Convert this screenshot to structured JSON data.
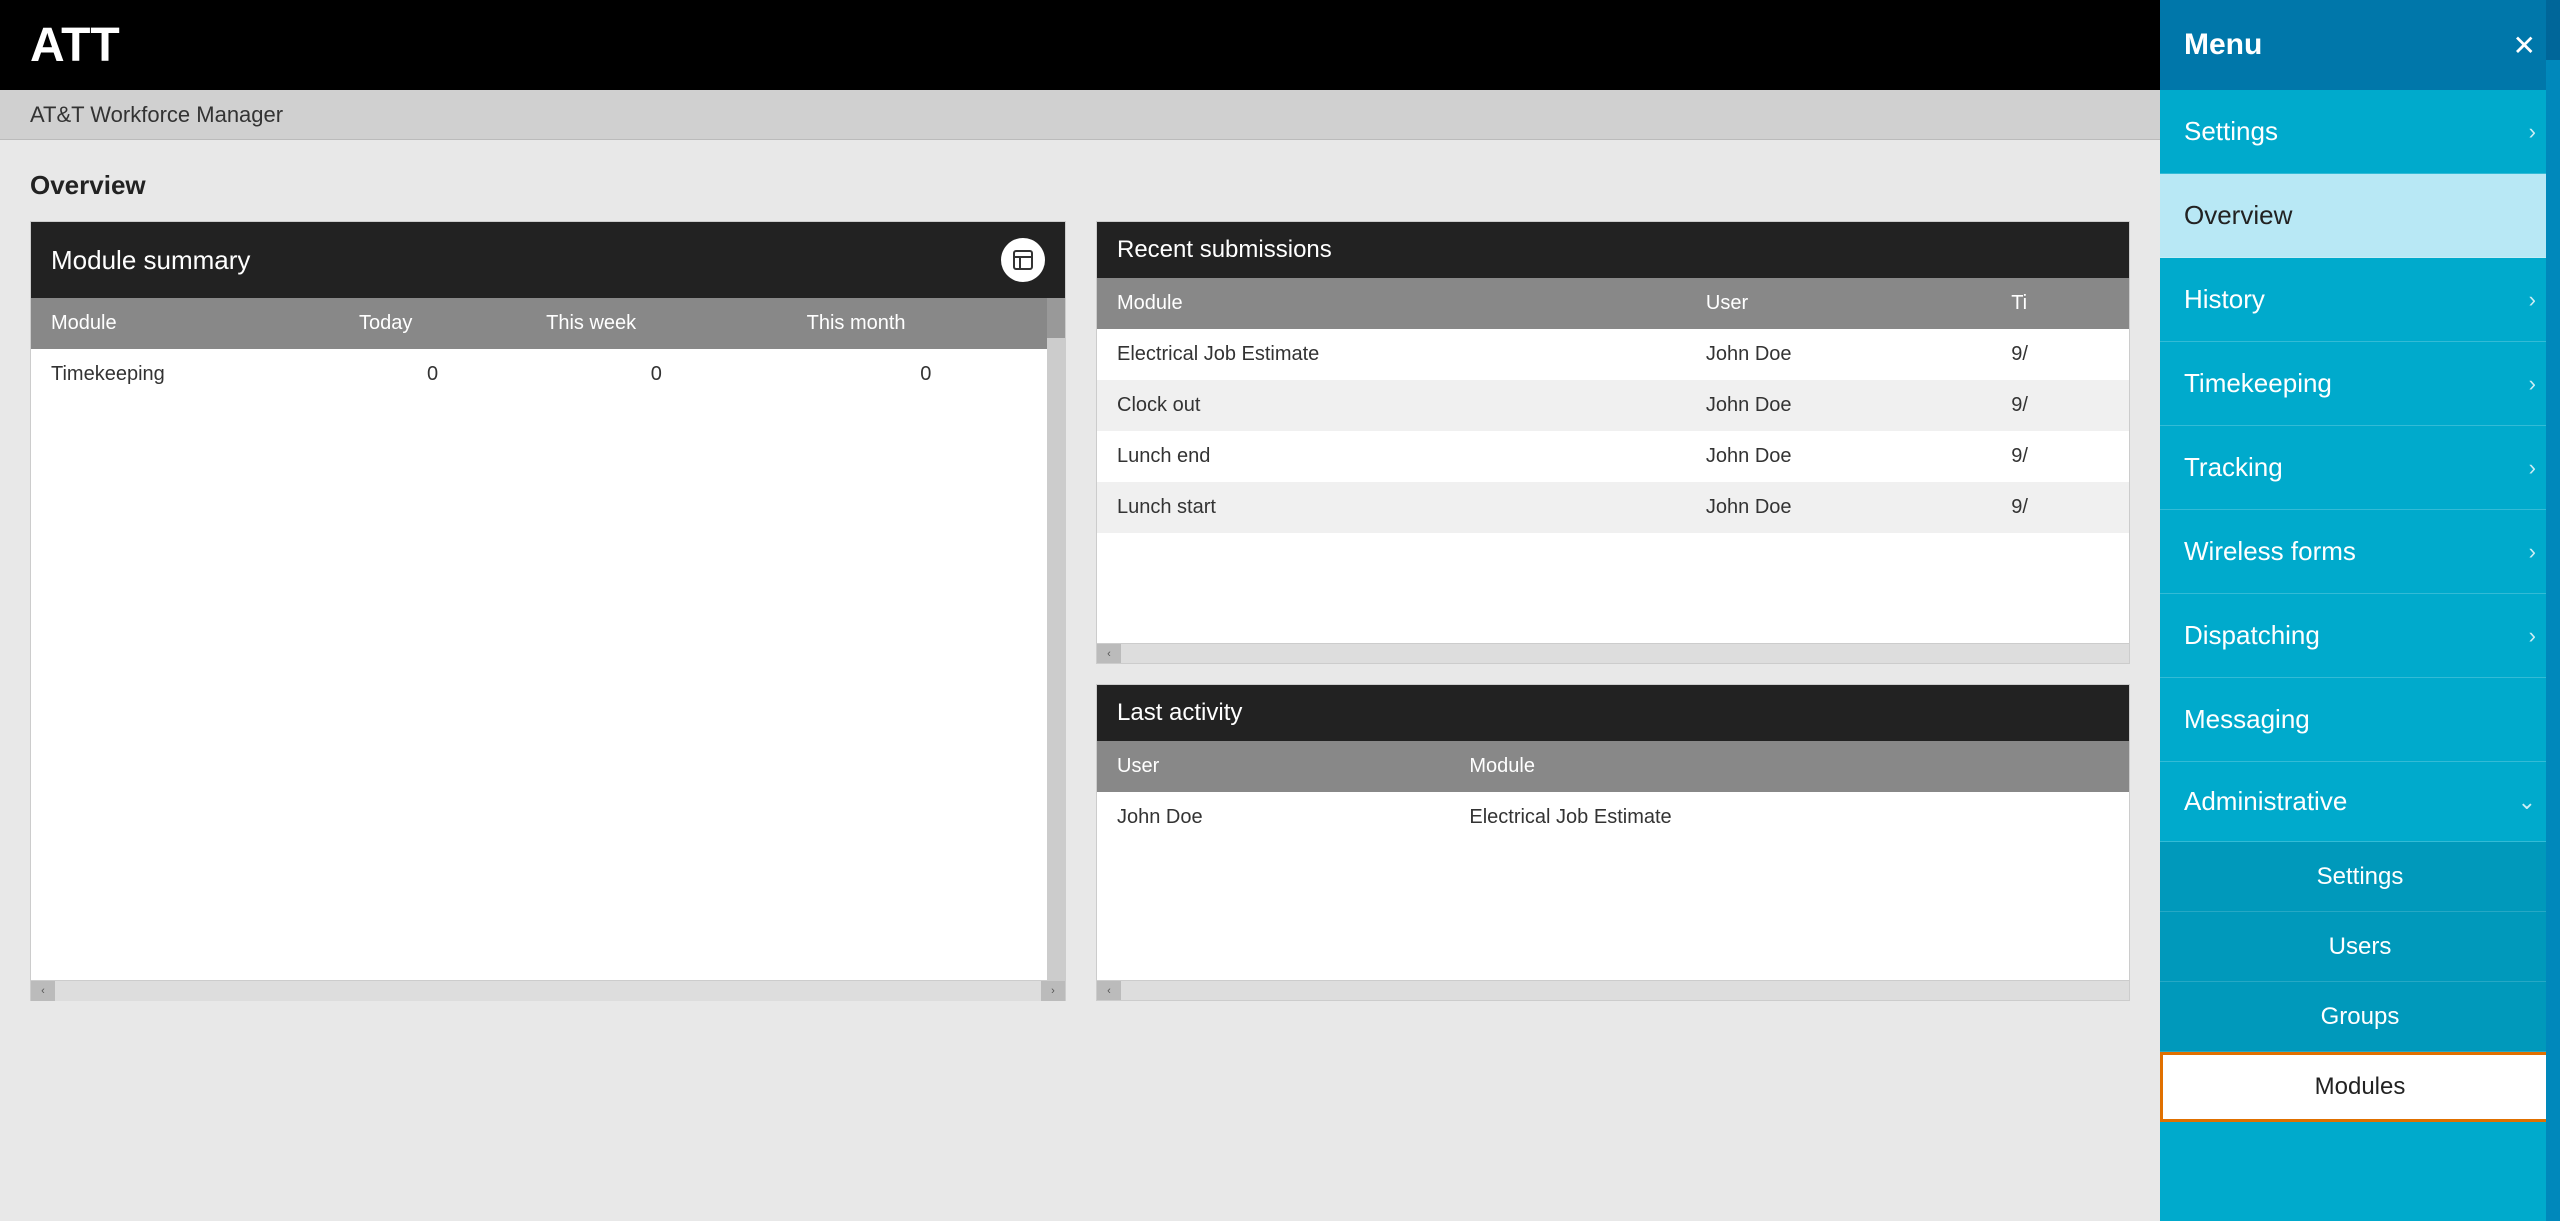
{
  "app": {
    "title": "ATT",
    "subtitle": "AT&T Workforce Manager"
  },
  "overview": {
    "title": "Overview"
  },
  "module_summary": {
    "panel_title": "Module summary",
    "columns": [
      "Module",
      "Today",
      "This week",
      "This month"
    ],
    "rows": [
      {
        "module": "Timekeeping",
        "today": "0",
        "this_week": "0",
        "this_month": "0"
      }
    ]
  },
  "recent_submissions": {
    "panel_title": "Recent submissions",
    "columns": [
      "Module",
      "User",
      "Ti"
    ],
    "rows": [
      {
        "module": "Electrical Job Estimate",
        "user": "John Doe",
        "time": "9/"
      },
      {
        "module": "Clock out",
        "user": "John Doe",
        "time": "9/"
      },
      {
        "module": "Lunch end",
        "user": "John Doe",
        "time": "9/"
      },
      {
        "module": "Lunch start",
        "user": "John Doe",
        "time": "9/"
      }
    ]
  },
  "last_activity": {
    "panel_title": "Last activity",
    "columns": [
      "User",
      "Module"
    ],
    "rows": [
      {
        "user": "John Doe",
        "module": "Electrical Job Estimate"
      }
    ]
  },
  "sidebar": {
    "menu_title": "Menu",
    "close_label": "✕",
    "items": [
      {
        "label": "Settings",
        "has_arrow": true,
        "active": false,
        "sub": false
      },
      {
        "label": "Overview",
        "has_arrow": false,
        "active": true,
        "sub": false
      },
      {
        "label": "History",
        "has_arrow": true,
        "active": false,
        "sub": false
      },
      {
        "label": "Timekeeping",
        "has_arrow": true,
        "active": false,
        "sub": false
      },
      {
        "label": "Tracking",
        "has_arrow": true,
        "active": false,
        "sub": false
      },
      {
        "label": "Wireless forms",
        "has_arrow": true,
        "active": false,
        "sub": false
      },
      {
        "label": "Dispatching",
        "has_arrow": true,
        "active": false,
        "sub": false
      },
      {
        "label": "Messaging",
        "has_arrow": false,
        "active": false,
        "sub": false
      },
      {
        "label": "Administrative",
        "has_arrow": false,
        "has_chevron_down": true,
        "active": false,
        "sub": false
      },
      {
        "label": "Settings",
        "has_arrow": false,
        "active": false,
        "sub": true
      },
      {
        "label": "Users",
        "has_arrow": false,
        "active": false,
        "sub": true
      },
      {
        "label": "Groups",
        "has_arrow": false,
        "active": false,
        "sub": true
      },
      {
        "label": "Modules",
        "has_arrow": false,
        "active": false,
        "sub": true,
        "highlighted": true
      }
    ]
  }
}
